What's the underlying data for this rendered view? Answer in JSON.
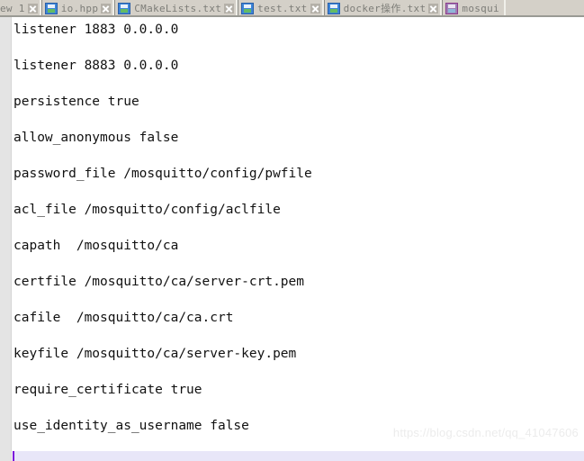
{
  "window": {
    "application": "Notepad++",
    "watermark": "https://blog.csdn.net/qq_41047606"
  },
  "tab_bar": {
    "icon_color": "#3d85d8",
    "active_icon_color": "#9d7fb5",
    "bar_color": "#d4d0c8",
    "label_color": "#7d7d78",
    "tabs": [
      {
        "label": "ew 1",
        "icon": "document-icon",
        "close_icon": "close-icon",
        "active": false,
        "truncated_left": true
      },
      {
        "label": "io.hpp",
        "icon": "document-icon",
        "close_icon": "close-icon",
        "active": false,
        "truncated_left": false
      },
      {
        "label": "CMakeLists.txt",
        "icon": "document-icon",
        "close_icon": "close-icon",
        "active": false,
        "truncated_left": false
      },
      {
        "label": "test.txt",
        "icon": "document-icon",
        "close_icon": "close-icon",
        "active": false,
        "truncated_left": false
      },
      {
        "label": "docker操作.txt",
        "icon": "document-icon",
        "close_icon": "close-icon",
        "active": false,
        "truncated_left": false
      },
      {
        "label": "mosqui",
        "icon": "document-modified-icon",
        "close_icon": "close-icon",
        "active": true,
        "truncated_left": false
      }
    ]
  },
  "editor": {
    "gutter_color": "#e4e4e4",
    "background_color": "#ffffff",
    "text_color": "#111111",
    "current_line_color": "#e8e6f8",
    "caret_color": "#7b0ddb",
    "lines": [
      "listener 1883 0.0.0.0",
      "listener 8883 0.0.0.0",
      "persistence true",
      "allow_anonymous false",
      "password_file /mosquitto/config/pwfile",
      "acl_file /mosquitto/config/aclfile",
      "capath  /mosquitto/ca",
      "certfile /mosquitto/ca/server-crt.pem",
      "cafile  /mosquitto/ca/ca.crt",
      "keyfile /mosquitto/ca/server-key.pem",
      "require_certificate true",
      "use_identity_as_username false"
    ]
  }
}
